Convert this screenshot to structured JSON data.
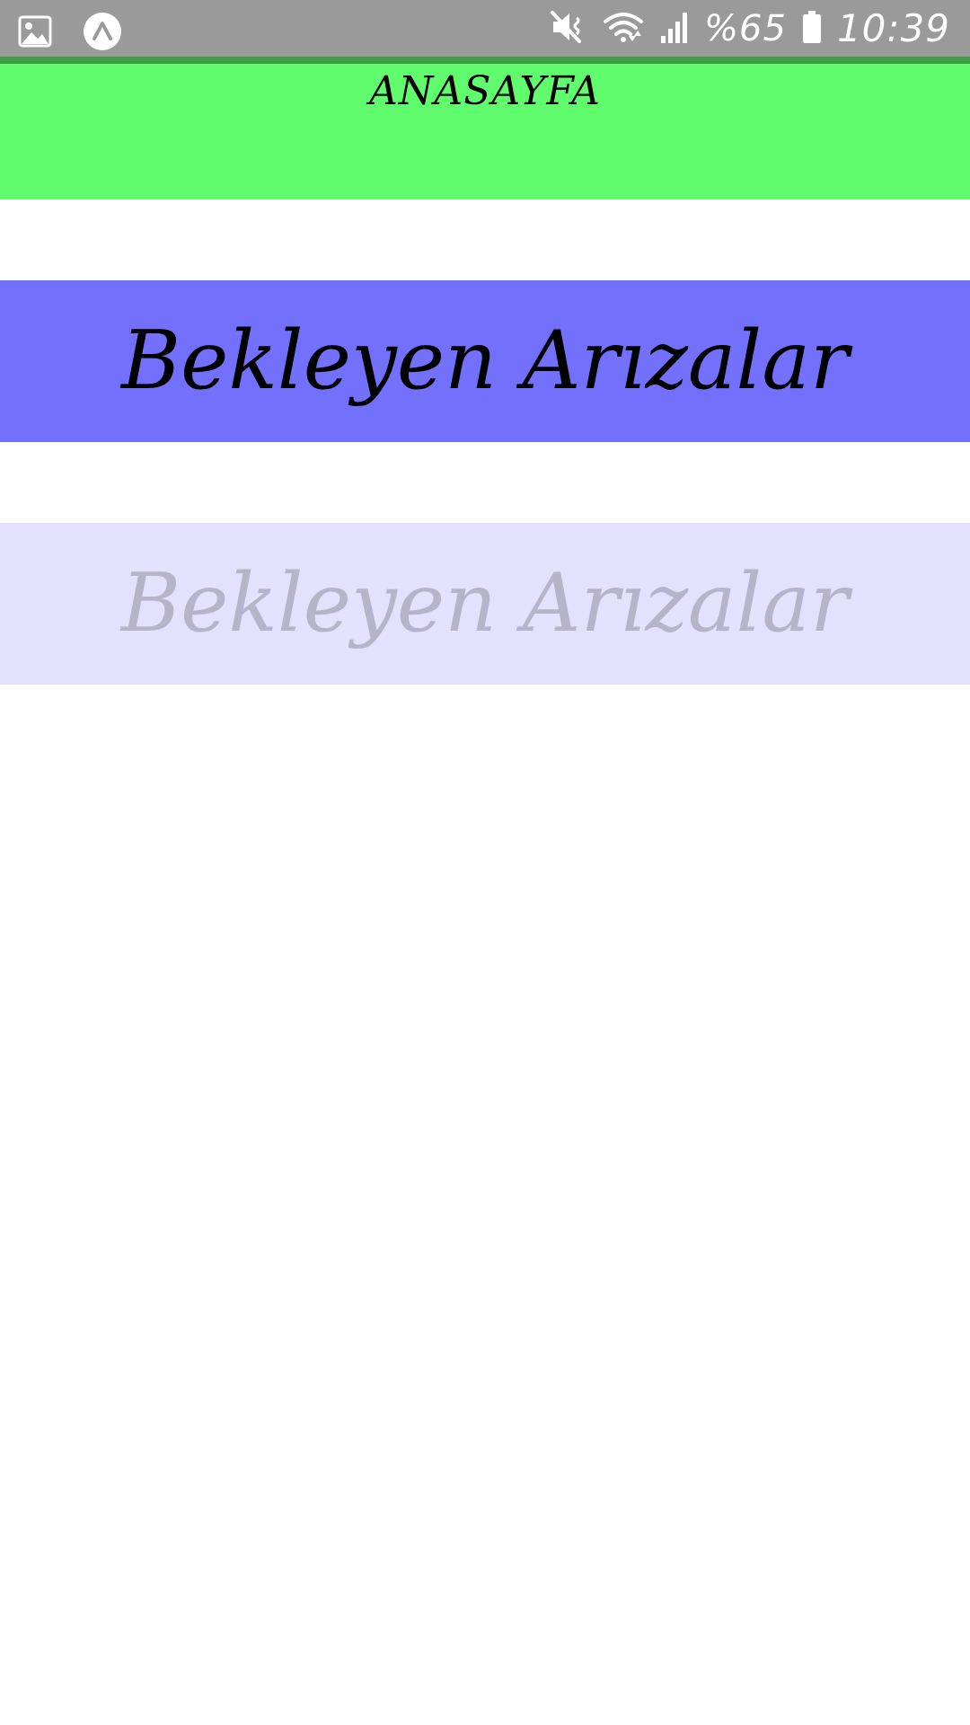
{
  "status_bar": {
    "background": "#9a9a9a",
    "left_icons": [
      "image-icon",
      "app-launcher-icon"
    ],
    "right_icons": [
      "mute-icon",
      "wifi-icon",
      "signal-icon",
      "battery-icon"
    ],
    "battery_percent": "%65",
    "time": "10:39"
  },
  "header": {
    "title": "ANASAYFA",
    "background": "#61fc6e"
  },
  "buttons": {
    "primary_label": "Bekleyen Arızalar",
    "primary_color": "#7470fe",
    "disabled_label": "Bekleyen Arızalar",
    "disabled_color": "#e3e1fe"
  }
}
